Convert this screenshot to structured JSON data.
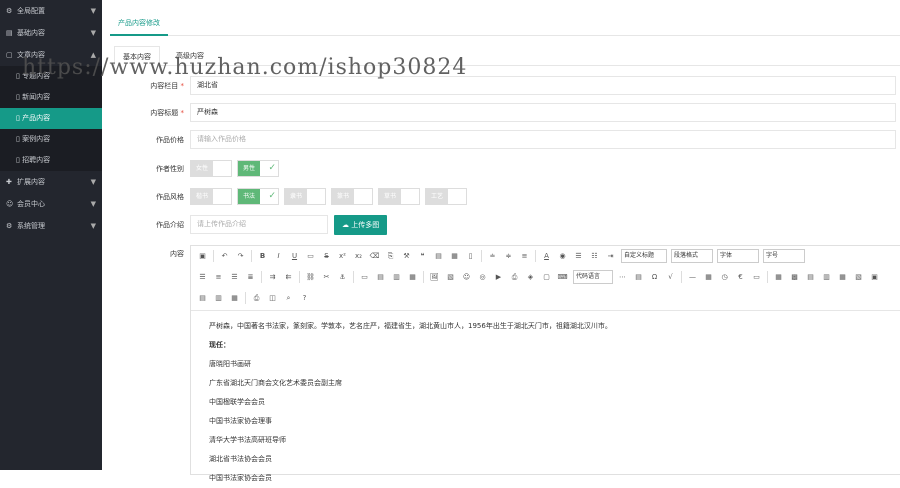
{
  "sidebar": {
    "items": [
      {
        "label": "全局配置",
        "icon": "gear-icon"
      },
      {
        "label": "基础内容",
        "icon": "grid-icon"
      },
      {
        "label": "文章内容",
        "icon": "doc-icon"
      }
    ],
    "sub_items": [
      {
        "label": "专题内容"
      },
      {
        "label": "新闻内容"
      },
      {
        "label": "产品内容"
      },
      {
        "label": "案例内容"
      },
      {
        "label": "招聘内容"
      }
    ],
    "items_after": [
      {
        "label": "扩展内容",
        "icon": "puzzle-icon"
      },
      {
        "label": "会员中心",
        "icon": "user-icon"
      },
      {
        "label": "系统管理",
        "icon": "gear-icon"
      }
    ]
  },
  "header": {
    "tab": "产品内容修改"
  },
  "tabs": [
    {
      "label": "基本内容"
    },
    {
      "label": "高级内容"
    }
  ],
  "form": {
    "category": {
      "label": "内容栏目",
      "value": "湖北省"
    },
    "title": {
      "label": "内容标题",
      "value": "严树森"
    },
    "price": {
      "label": "作品价格",
      "placeholder": "请输入作品价格"
    },
    "gender": {
      "label": "作者性别",
      "options": [
        "女性",
        "男性"
      ]
    },
    "style": {
      "label": "作品风格",
      "options": [
        "楷书",
        "书法",
        "隶书",
        "篆书",
        "草书",
        "工艺"
      ]
    },
    "intro": {
      "label": "作品介绍",
      "placeholder": "请上传作品介绍",
      "button": "上传多图"
    },
    "content": {
      "label": "内容"
    }
  },
  "editor": {
    "selects": [
      "自定义标题",
      "段落格式",
      "字体",
      "字号",
      "代码语言"
    ],
    "paragraphs": [
      "严树森，中国著名书法家，篆刻家。学敦本，艺名庄严，福建省生，湖北黄山市人，1956年出生于湖北天门市，祖籍湖北汉川市。",
      "现任：",
      "唐晓阳书画研",
      "广东省湖北天门商会文化艺术委员会副主席",
      "中国楹联学会会员",
      "中国书法家协会理事",
      "清华大学书法高研班导师",
      "湖北省书法协会会员",
      "中国书法家协会会员"
    ]
  },
  "watermark": "https://www.huzhan.com/ishop30824",
  "colors": {
    "accent": "#159a88",
    "sidebar_bg": "#23262e",
    "switch_on": "#5fb878"
  }
}
